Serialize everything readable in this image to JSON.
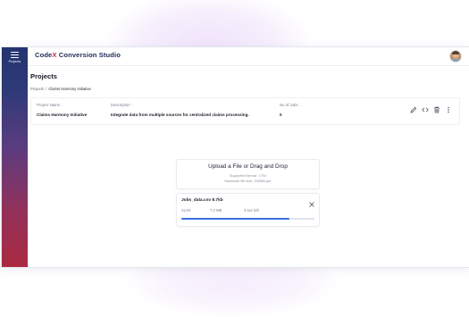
{
  "sidebar": {
    "menu_label": "Projects"
  },
  "header": {
    "brand_prefix": "Code",
    "brand_x": "X",
    "brand_suffix": " Conversion Studio"
  },
  "page": {
    "title": "Projects"
  },
  "breadcrumb": {
    "root": "Projects",
    "separator": "/",
    "current": "Claims Harmony Initiative"
  },
  "project": {
    "name_label": "Project Name :",
    "name": "Claims Harmony Initiative",
    "description_label": "Description :",
    "description": "Integrate data from multiple sources for centralized claims processing.",
    "jobs_label": "No of Jobs :",
    "jobs": "0",
    "actions": [
      "pencil-icon",
      "code-icon",
      "trash-icon",
      "more-vertical-icon"
    ]
  },
  "upload": {
    "title": "Upload a File or Drag and Drop",
    "supported": "Supported format : CSV",
    "max_size": "Maximum file size: 200MB per"
  },
  "file": {
    "name": "Jobs_data.csv 8.7kb",
    "type": "XLSX",
    "size": "7.2 MB",
    "time_left": "3 sec left",
    "progress": 0.81
  },
  "colors": {
    "accent": "#3a6fe0",
    "brand": "#1f2a5a",
    "brand_x": "#c93040"
  }
}
